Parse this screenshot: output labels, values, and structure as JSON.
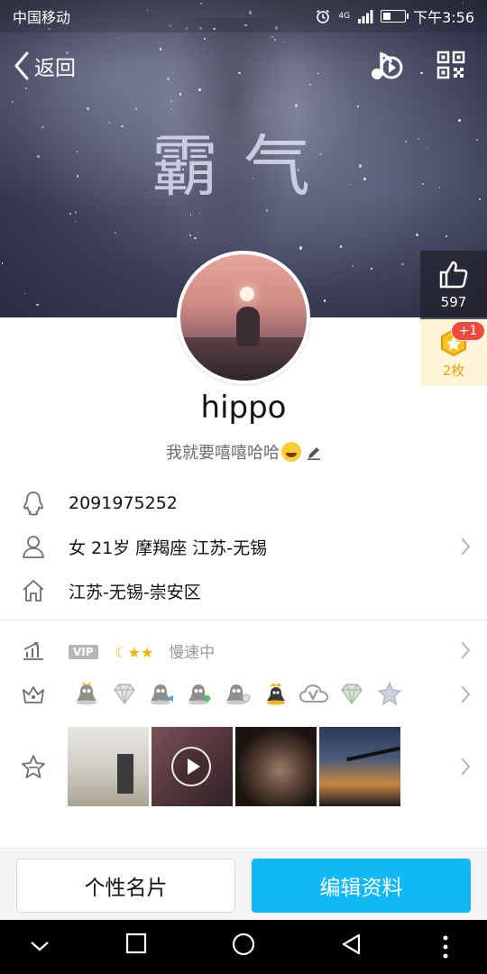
{
  "status_bar": {
    "carrier": "中国移动",
    "network": "4G",
    "time": "下午3:56"
  },
  "nav": {
    "back_label": "返回"
  },
  "cover": {
    "art_text": "霸气"
  },
  "likes": {
    "count": "597"
  },
  "badge": {
    "count": "2枚",
    "plus": "+1"
  },
  "profile": {
    "username": "hippo",
    "signature": "我就要嘻嘻哈哈"
  },
  "info": {
    "qq_number": "2091975252",
    "basic": "女  21岁  摩羯座  江苏-无锡",
    "hometown": "江苏-无锡-崇安区"
  },
  "vip": {
    "tag": "VIP",
    "level_icons": "☾★★",
    "speed": "慢速中"
  },
  "medals": [
    "penguin-medal",
    "diamond-medal",
    "penguin-medal",
    "penguin-medal",
    "penguin-medal",
    "crown-penguin-medal",
    "cloud-v-medal",
    "diamond-medal",
    "star-medal"
  ],
  "photos": [
    "room-photo",
    "video-thumb",
    "portrait-photo",
    "sunset-photo"
  ],
  "actions": {
    "card_label": "个性名片",
    "edit_label": "编辑资料"
  },
  "colors": {
    "accent": "#12b7f5",
    "badge_red": "#f14a3c",
    "badge_gold": "#e8a20c"
  }
}
